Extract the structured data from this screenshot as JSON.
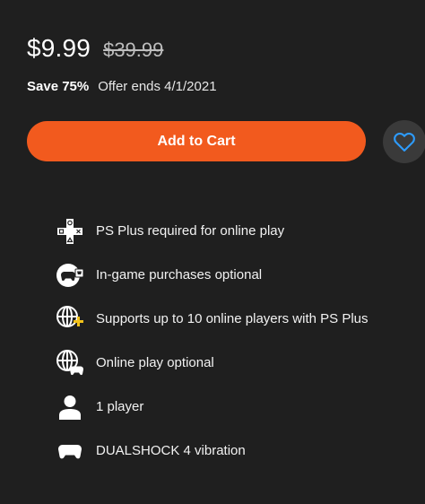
{
  "pricing": {
    "current_price": "$9.99",
    "original_price": "$39.99",
    "save_label": "Save 75%",
    "offer_label": "Offer ends 4/1/2021"
  },
  "actions": {
    "add_to_cart_label": "Add to Cart",
    "wishlist_icon": "heart-outline-icon"
  },
  "colors": {
    "background": "#1f1f1f",
    "cart_button": "#f25a1e",
    "wishlist_circle": "#3a3a3a",
    "wishlist_heart": "#2d9cff",
    "ps_plus_yellow": "#f3c21a"
  },
  "features": [
    {
      "icon": "ps-plus-icon",
      "label": "PS Plus required for online play"
    },
    {
      "icon": "in-game-purchases-icon",
      "label": "In-game purchases optional"
    },
    {
      "icon": "online-players-ps-plus-icon",
      "label": "Supports up to 10 online players with PS Plus"
    },
    {
      "icon": "online-play-icon",
      "label": "Online play optional"
    },
    {
      "icon": "player-icon",
      "label": "1 player"
    },
    {
      "icon": "controller-icon",
      "label": "DUALSHOCK 4 vibration"
    }
  ]
}
